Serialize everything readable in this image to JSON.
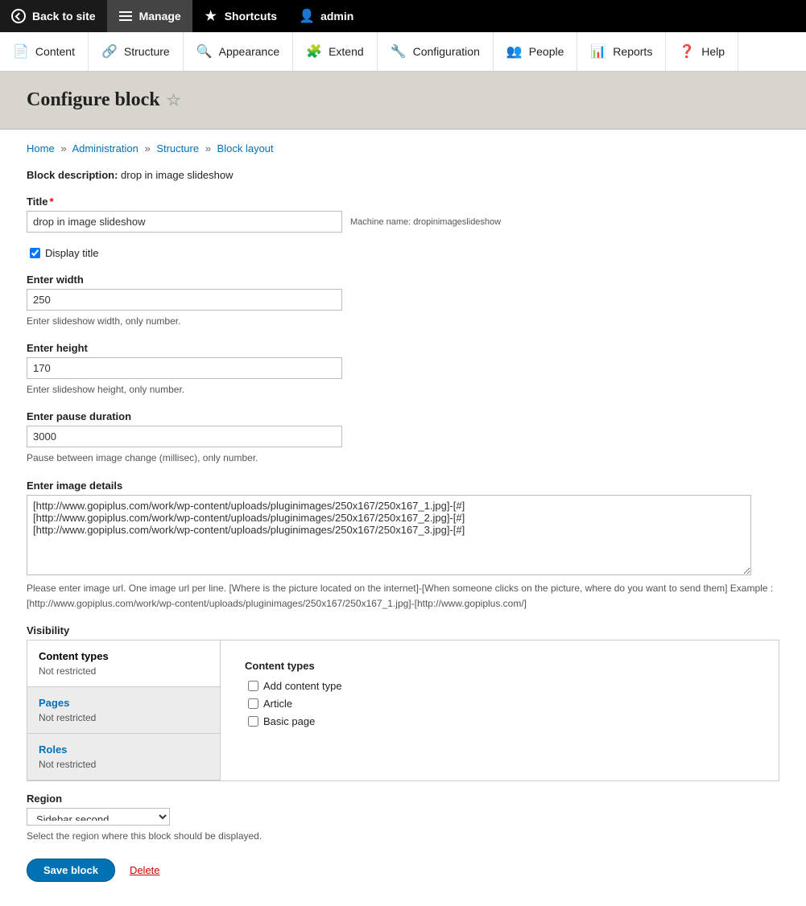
{
  "toolbar": {
    "back": "Back to site",
    "manage": "Manage",
    "shortcuts": "Shortcuts",
    "user": "admin"
  },
  "admin_menu": {
    "content": "Content",
    "structure": "Structure",
    "appearance": "Appearance",
    "extend": "Extend",
    "configuration": "Configuration",
    "people": "People",
    "reports": "Reports",
    "help": "Help"
  },
  "page": {
    "title": "Configure block"
  },
  "breadcrumb": {
    "home": "Home",
    "administration": "Administration",
    "structure": "Structure",
    "block_layout": "Block layout"
  },
  "block_desc_label": "Block description:",
  "block_desc_value": " drop in image slideshow",
  "fields": {
    "title": {
      "label": "Title",
      "value": "drop in image slideshow",
      "machine_label": "Machine name: ",
      "machine_value": "dropinimageslideshow"
    },
    "display_title": {
      "label": "Display title",
      "checked": true
    },
    "width": {
      "label": "Enter width",
      "value": "250",
      "help": "Enter slideshow width, only number."
    },
    "height": {
      "label": "Enter height",
      "value": "170",
      "help": "Enter slideshow height, only number."
    },
    "pause": {
      "label": "Enter pause duration",
      "value": "3000",
      "help": "Pause between image change (millisec), only number."
    },
    "image_details": {
      "label": "Enter image details",
      "value": "[http://www.gopiplus.com/work/wp-content/uploads/pluginimages/250x167/250x167_1.jpg]-[#]\n[http://www.gopiplus.com/work/wp-content/uploads/pluginimages/250x167/250x167_2.jpg]-[#]\n[http://www.gopiplus.com/work/wp-content/uploads/pluginimages/250x167/250x167_3.jpg]-[#]",
      "help": "Please enter image url. One image url per line. [Where is the picture located on the internet]-[When someone clicks on the picture, where do you want to send them] Example : [http://www.gopiplus.com/work/wp-content/uploads/pluginimages/250x167/250x167_1.jpg]-[http://www.gopiplus.com/]"
    }
  },
  "visibility": {
    "title": "Visibility",
    "tabs": [
      {
        "label": "Content types",
        "sub": "Not restricted"
      },
      {
        "label": "Pages",
        "sub": "Not restricted"
      },
      {
        "label": "Roles",
        "sub": "Not restricted"
      }
    ],
    "panel": {
      "title": "Content types",
      "options": [
        "Add content type",
        "Article",
        "Basic page"
      ]
    }
  },
  "region": {
    "label": "Region",
    "value": "Sidebar second",
    "help": "Select the region where this block should be displayed."
  },
  "actions": {
    "save": "Save block",
    "delete": "Delete"
  }
}
